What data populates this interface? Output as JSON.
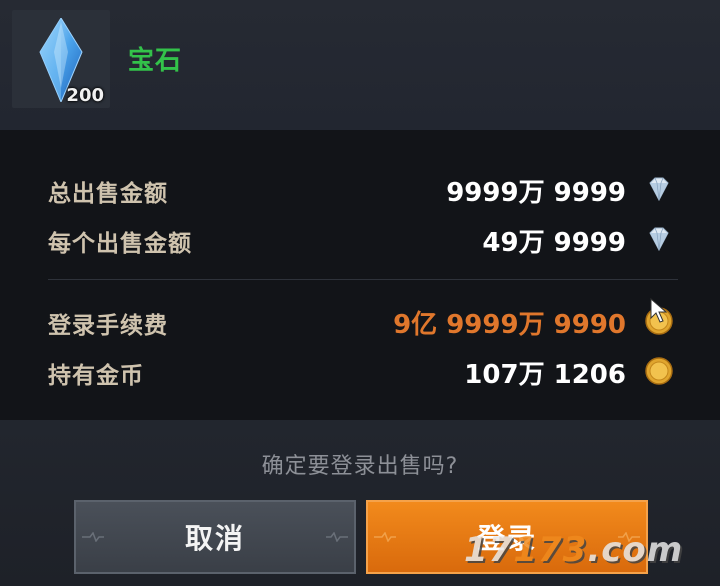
{
  "item": {
    "name": "宝石",
    "count": "200",
    "icon": "blue-crystal-icon"
  },
  "rows": {
    "total": {
      "label": "总出售金额",
      "value": "9999万 9999",
      "icon": "diamond-icon"
    },
    "each": {
      "label": "每个出售金额",
      "value": "49万 9999",
      "icon": "diamond-icon"
    },
    "fee": {
      "label": "登录手续费",
      "value": "9亿 9999万 9990",
      "icon": "gold-coin-icon",
      "color": "#e0772c"
    },
    "gold": {
      "label": "持有金币",
      "value": "107万 1206",
      "icon": "gold-coin-icon"
    }
  },
  "confirm_text": "确定要登录出售吗?",
  "buttons": {
    "cancel": "取消",
    "login": "登录"
  },
  "watermark": {
    "prefix": "17",
    "highlight": "173",
    "suffix": ".com"
  },
  "colors": {
    "item_name": "#33c24a",
    "label": "#cfc3ae",
    "login_button": "#e57a14",
    "cancel_button": "#434951"
  }
}
